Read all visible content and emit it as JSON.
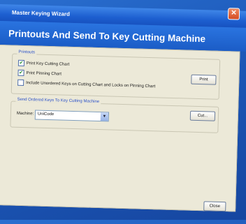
{
  "window": {
    "title": "Master Keying Wizard",
    "close_glyph": "✕",
    "header_title": "Printouts And Send To Key Cutting Machine"
  },
  "printouts": {
    "group_label": "Printouts",
    "options": [
      {
        "label": "Print Key Cutting Chart",
        "checked": true
      },
      {
        "label": "Print Pinning Chart",
        "checked": true
      },
      {
        "label": "Include Unordered Keys on Cutting Chart and Locks on Pinning Chart",
        "checked": false
      }
    ],
    "print_button": "Print"
  },
  "send": {
    "group_label": "Send Ordered Keys To Key Cutting Machine",
    "machine_label": "Machine:",
    "machine_value": "UniCode",
    "cut_button": "Cut..."
  },
  "footer": {
    "close_button": "Close"
  }
}
